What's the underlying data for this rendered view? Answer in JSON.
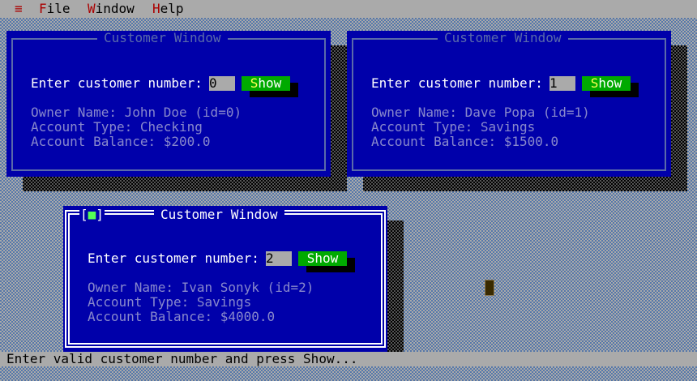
{
  "menu": {
    "system_icon": "≡",
    "items": [
      {
        "hot": "F",
        "rest": "ile"
      },
      {
        "hot": "W",
        "rest": "indow"
      },
      {
        "hot": "H",
        "rest": "elp"
      }
    ]
  },
  "windows": [
    {
      "title": "Customer Window",
      "prompt": "Enter customer number:",
      "input_value": "0",
      "button_hot": "S",
      "button_rest": "how",
      "owner_line": "Owner Name: John Doe (id=0)",
      "type_line": "Account Type: Checking",
      "balance_line": "Account Balance: $200.0"
    },
    {
      "title": "Customer Window",
      "prompt": "Enter customer number:",
      "input_value": "1",
      "button_hot": "S",
      "button_rest": "how",
      "owner_line": "Owner Name: Dave Popa (id=1)",
      "type_line": "Account Type: Savings",
      "balance_line": "Account Balance: $1500.0"
    },
    {
      "title": "Customer Window",
      "close_symbol": "[■]",
      "prompt": "Enter customer number:",
      "input_value": "2",
      "button_label": "Show",
      "owner_line": "Owner Name: Ivan Sonyk (id=2)",
      "type_line": "Account Type: Savings",
      "balance_line": "Account Balance: $4000.0"
    }
  ],
  "status": {
    "text": "Enter valid customer number and press Show..."
  },
  "colors": {
    "desktop": "#aaaaaa",
    "window_bg": "#0000aa",
    "button_bg": "#00aa00",
    "hotkey": "#aa0000"
  }
}
